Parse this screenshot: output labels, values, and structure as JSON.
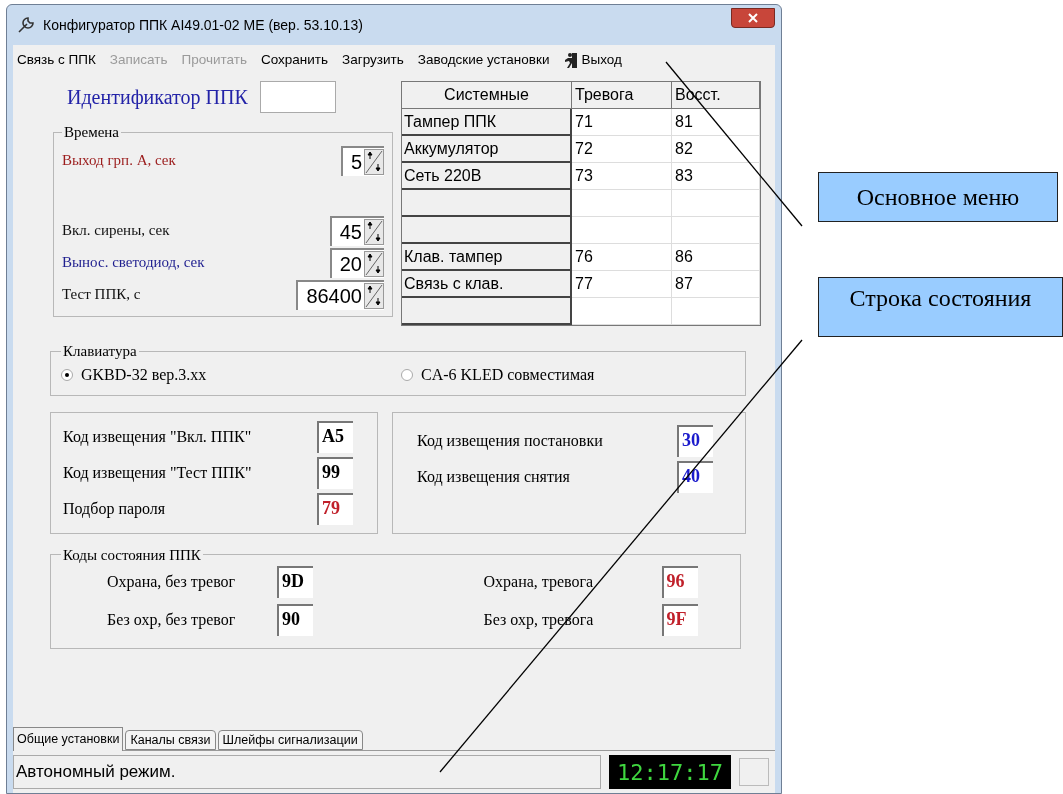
{
  "window": {
    "title": "Конфигуратор ППК AI49.01-02 МЕ (вер. 53.10.13)"
  },
  "menu": [
    {
      "label": "Связь с ППК",
      "disabled": false
    },
    {
      "label": "Записать",
      "disabled": true
    },
    {
      "label": "Прочитать",
      "disabled": true
    },
    {
      "label": "Сохранить",
      "disabled": false
    },
    {
      "label": "Загрузить",
      "disabled": false
    },
    {
      "label": "Заводские установки",
      "disabled": false
    },
    {
      "label": "Выход",
      "disabled": false,
      "kind": "exit"
    }
  ],
  "identifier": {
    "label": "Идентификатор ППК"
  },
  "times": {
    "title": "Времена",
    "fields": [
      {
        "label": "Выход  грп. А, сек",
        "value": "5",
        "color": "#9b1c1c"
      },
      {
        "label": "Вкл. сирены, сек",
        "value": "45",
        "color": "#111111"
      },
      {
        "label": "Вынос. светодиод, сек",
        "value": "20",
        "color": "#1f1f8f"
      },
      {
        "label": "Тест ППК,  с",
        "value": "86400",
        "color": "#111111"
      }
    ]
  },
  "system_table": {
    "columns": [
      "Системные",
      "Тревога",
      "Восст."
    ],
    "rows": [
      {
        "name": "Тампер ППК",
        "alarm": "71",
        "restore": "81"
      },
      {
        "name": "Аккумулятор",
        "alarm": "72",
        "restore": "82"
      },
      {
        "name": "Сеть 220В",
        "alarm": "73",
        "restore": "83"
      },
      {},
      {},
      {
        "name": "Клав. тампер",
        "alarm": "76",
        "restore": "86"
      },
      {
        "name": "Связь с клав.",
        "alarm": "77",
        "restore": "87"
      },
      {}
    ]
  },
  "keyboard": {
    "title": "Клавиатура",
    "options": [
      {
        "label": "GKBD-32 вер.3.xx",
        "selected": true
      },
      {
        "label": "CA-6 KLED совместимая",
        "selected": false
      }
    ]
  },
  "notification_codes_left": [
    {
      "label": "Код извещения \"Вкл. ППК\"",
      "value": "A5",
      "color": "#000000"
    },
    {
      "label": "Код извещения \"Тест ППК\"",
      "value": "99",
      "color": "#000000"
    },
    {
      "label": "Подбор пароля",
      "value": "79",
      "color": "#c0202a"
    }
  ],
  "notification_codes_right": [
    {
      "label": "Код извещения постановки",
      "value": "30",
      "color": "#1a1acc"
    },
    {
      "label": "Код извещения снятия",
      "value": "40",
      "color": "#1a1acc"
    }
  ],
  "status_codes": {
    "title": "Коды состояния ППК",
    "items": [
      {
        "label": "Охрана, без тревог",
        "value": "9D",
        "color": "#000000"
      },
      {
        "label": "Охрана, тревога",
        "value": "96",
        "color": "#c0202a"
      },
      {
        "label": "Без охр, без тревог",
        "value": "90",
        "color": "#000000"
      },
      {
        "label": "Без охр, тревога",
        "value": "9F",
        "color": "#c0202a"
      }
    ]
  },
  "tabs": [
    {
      "label": "Общие установки",
      "selected": true
    },
    {
      "label": "Каналы связи",
      "selected": false
    },
    {
      "label": "Шлейфы сигнализации",
      "selected": false
    }
  ],
  "status_bar": {
    "text": "Автономный режим.",
    "clock": "12:17:17"
  },
  "callouts": [
    {
      "text": "Основное меню"
    },
    {
      "text": "Строка состояния"
    }
  ]
}
